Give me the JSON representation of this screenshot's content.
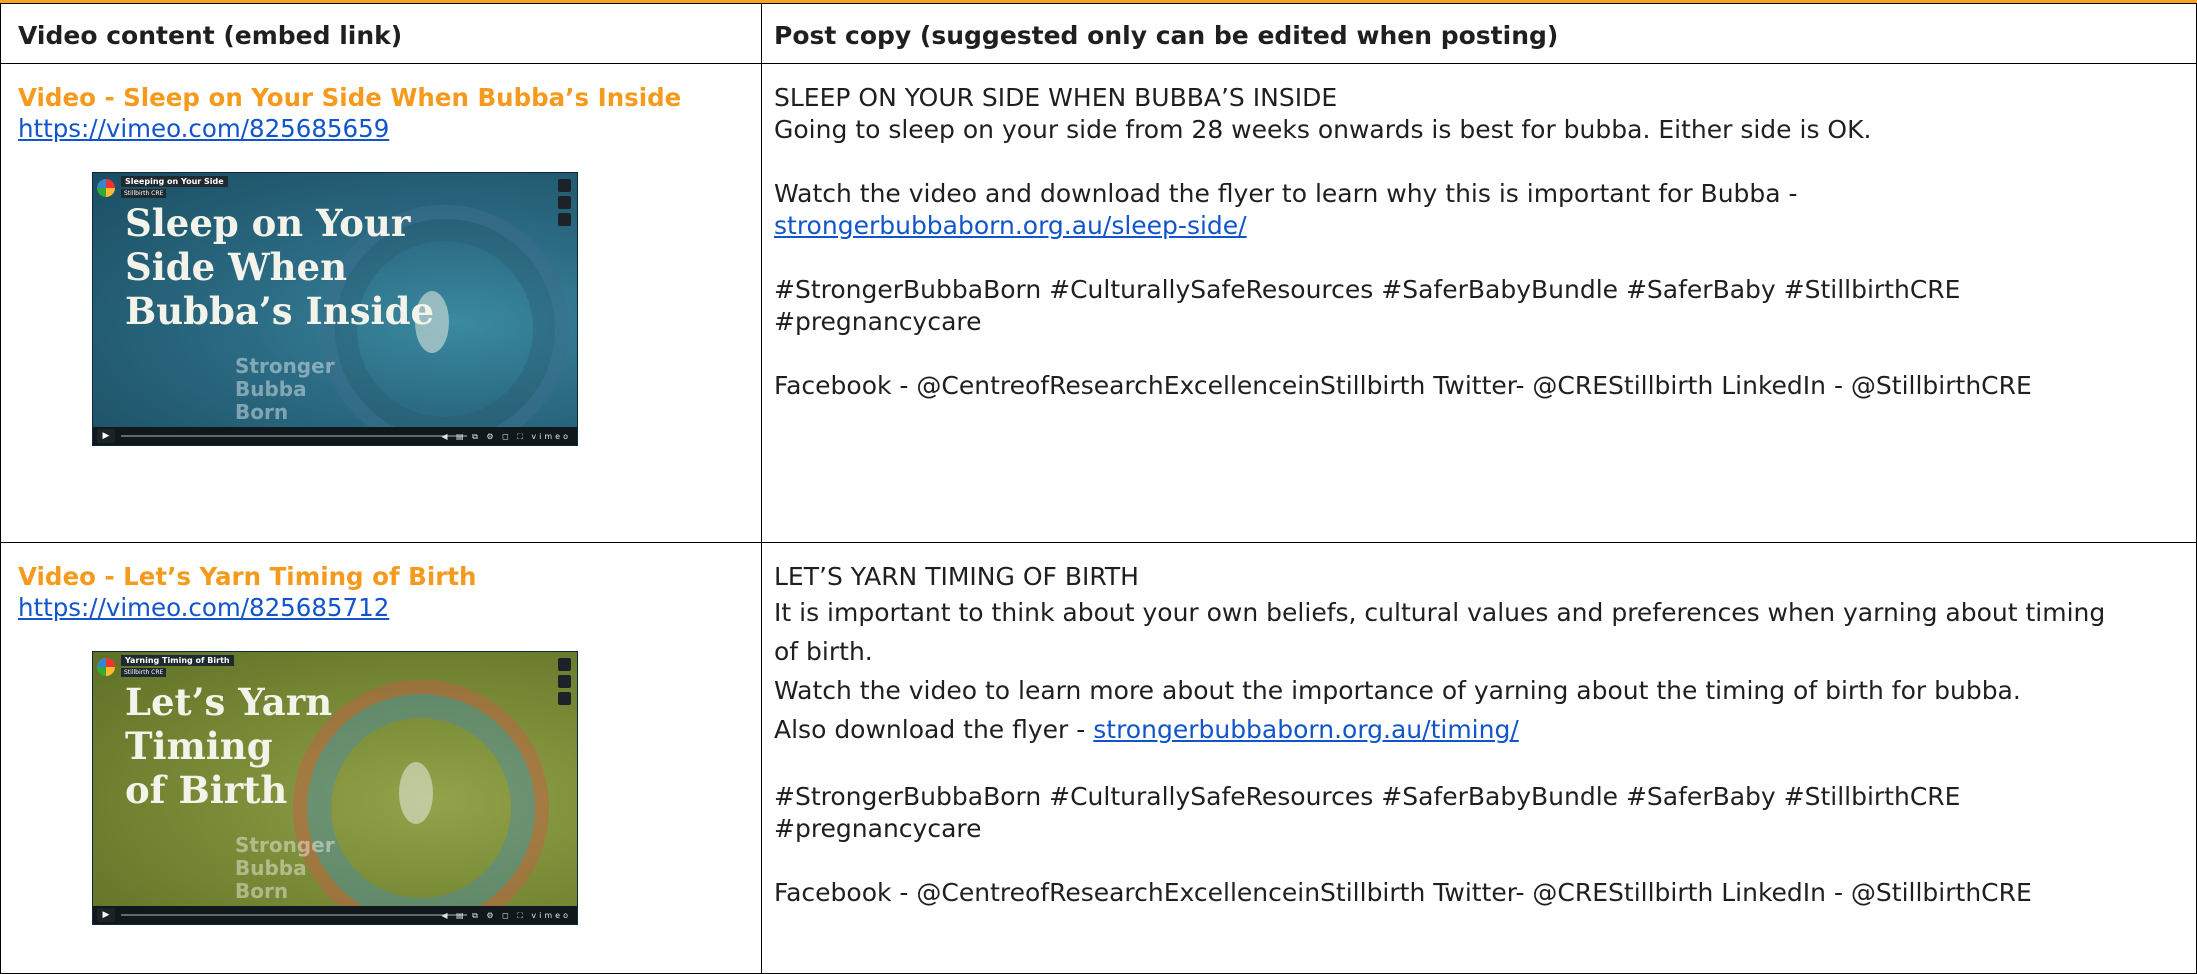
{
  "header": {
    "col1": "Video content (embed link)",
    "col2": "Post copy (suggested only can be edited when posting)"
  },
  "rows": [
    {
      "video_title": "Video - Sleep on Your Side When Bubba’s Inside",
      "video_url": "https://vimeo.com/825685659",
      "thumbnail": {
        "chip_title": "Sleeping on Your Side",
        "chip_sub": "Stillbirth CRE",
        "big_title": "Sleep on Your\nSide When\nBubba’s Inside",
        "brand": "Stronger\nBubba\nBorn",
        "play_icon": "play-icon",
        "tools": "◀ ▤ ⧉ ⚙ ◻ ⛶ vimeo"
      },
      "copy": {
        "heading": "SLEEP ON YOUR SIDE WHEN BUBBA’S INSIDE",
        "line1": "Going to sleep on your side from 28 weeks onwards is best for bubba. Either side is OK.",
        "line2": "Watch the video and download the flyer to learn why this is important for Bubba -",
        "link": "strongerbubbaborn.org.au/sleep-side/",
        "hashtags": "#StrongerBubbaBorn #CulturallySafeResources #SaferBabyBundle #SaferBaby #StillbirthCRE",
        "hashtags2": "#pregnancycare",
        "social": "Facebook - @CentreofResearchExcellenceinStillbirth  Twitter-  @CREStillbirth   LinkedIn -  @StillbirthCRE"
      }
    },
    {
      "video_title": "Video - Let’s Yarn Timing of Birth",
      "video_url": "https://vimeo.com/825685712",
      "thumbnail": {
        "chip_title": "Yarning Timing of Birth",
        "chip_sub": "Stillbirth CRE",
        "big_title": "Let’s Yarn\nTiming\nof Birth",
        "brand": "Stronger\nBubba\nBorn",
        "play_icon": "play-icon",
        "tools": "◀ ▤ ⧉ ⚙ ◻ ⛶ vimeo"
      },
      "copy": {
        "heading": "LET’S YARN TIMING OF BIRTH",
        "line1": "It is important to think about your own beliefs, cultural values and preferences when yarning about timing",
        "line1b": "of birth.",
        "line2": "Watch the video to learn more about the importance of yarning about the timing of birth for bubba.",
        "line3": "Also download the flyer - ",
        "link": "strongerbubbaborn.org.au/timing/",
        "hashtags": "#StrongerBubbaBorn #CulturallySafeResources #SaferBabyBundle #SaferBaby #StillbirthCRE",
        "hashtags2": "#pregnancycare",
        "social": "Facebook - @CentreofResearchExcellenceinStillbirth  Twitter-  @CREStillbirth   LinkedIn -  @StillbirthCRE"
      }
    }
  ]
}
